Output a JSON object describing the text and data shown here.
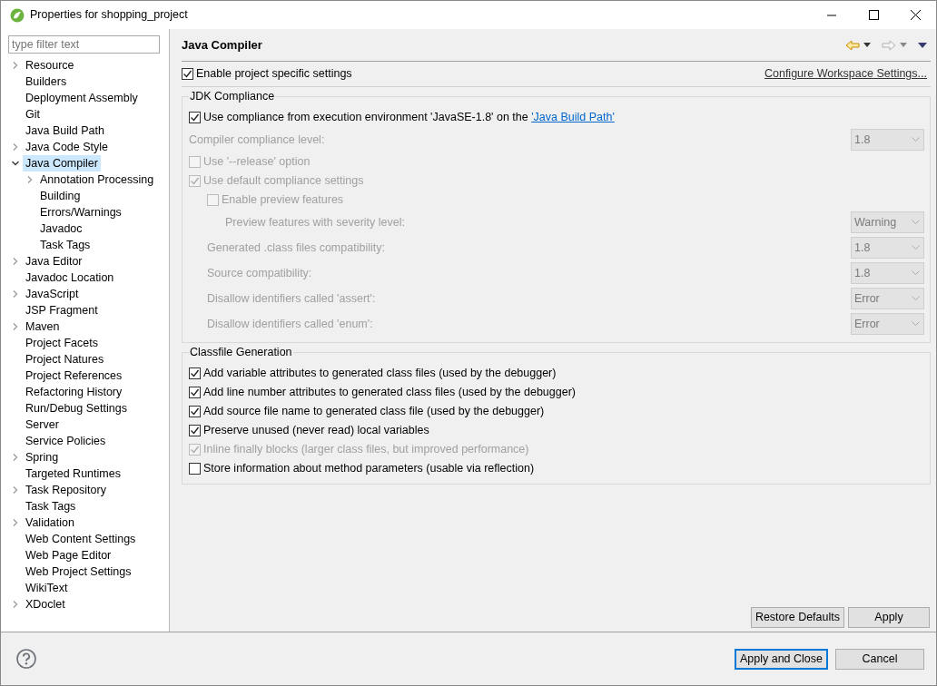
{
  "window": {
    "title": "Properties for shopping_project"
  },
  "sidebar": {
    "filter_placeholder": "type filter text",
    "items": [
      {
        "label": "Resource",
        "kind": "folder",
        "expanded": false,
        "selected": false
      },
      {
        "label": "Builders",
        "kind": "leaf",
        "selected": false
      },
      {
        "label": "Deployment Assembly",
        "kind": "leaf",
        "selected": false
      },
      {
        "label": "Git",
        "kind": "leaf",
        "selected": false
      },
      {
        "label": "Java Build Path",
        "kind": "leaf",
        "selected": false
      },
      {
        "label": "Java Code Style",
        "kind": "folder",
        "expanded": false,
        "selected": false
      },
      {
        "label": "Java Compiler",
        "kind": "folder",
        "expanded": true,
        "selected": true,
        "children": [
          {
            "label": "Annotation Processing",
            "kind": "folder",
            "expanded": false,
            "selected": false
          },
          {
            "label": "Building",
            "kind": "leaf",
            "selected": false
          },
          {
            "label": "Errors/Warnings",
            "kind": "leaf",
            "selected": false
          },
          {
            "label": "Javadoc",
            "kind": "leaf",
            "selected": false
          },
          {
            "label": "Task Tags",
            "kind": "leaf",
            "selected": false
          }
        ]
      },
      {
        "label": "Java Editor",
        "kind": "folder",
        "expanded": false,
        "selected": false
      },
      {
        "label": "Javadoc Location",
        "kind": "leaf",
        "selected": false
      },
      {
        "label": "JavaScript",
        "kind": "folder",
        "expanded": false,
        "selected": false
      },
      {
        "label": "JSP Fragment",
        "kind": "leaf",
        "selected": false
      },
      {
        "label": "Maven",
        "kind": "folder",
        "expanded": false,
        "selected": false
      },
      {
        "label": "Project Facets",
        "kind": "leaf",
        "selected": false
      },
      {
        "label": "Project Natures",
        "kind": "leaf",
        "selected": false
      },
      {
        "label": "Project References",
        "kind": "leaf",
        "selected": false
      },
      {
        "label": "Refactoring History",
        "kind": "leaf",
        "selected": false
      },
      {
        "label": "Run/Debug Settings",
        "kind": "leaf",
        "selected": false
      },
      {
        "label": "Server",
        "kind": "leaf",
        "selected": false
      },
      {
        "label": "Service Policies",
        "kind": "leaf",
        "selected": false
      },
      {
        "label": "Spring",
        "kind": "folder",
        "expanded": false,
        "selected": false
      },
      {
        "label": "Targeted Runtimes",
        "kind": "leaf",
        "selected": false
      },
      {
        "label": "Task Repository",
        "kind": "folder",
        "expanded": false,
        "selected": false
      },
      {
        "label": "Task Tags",
        "kind": "leaf",
        "selected": false
      },
      {
        "label": "Validation",
        "kind": "folder",
        "expanded": false,
        "selected": false
      },
      {
        "label": "Web Content Settings",
        "kind": "leaf",
        "selected": false
      },
      {
        "label": "Web Page Editor",
        "kind": "leaf",
        "selected": false
      },
      {
        "label": "Web Project Settings",
        "kind": "leaf",
        "selected": false
      },
      {
        "label": "WikiText",
        "kind": "leaf",
        "selected": false
      },
      {
        "label": "XDoclet",
        "kind": "folder",
        "expanded": false,
        "selected": false
      }
    ]
  },
  "page": {
    "title": "Java Compiler",
    "project_specific": {
      "label": "Enable project specific settings",
      "checked": true
    },
    "workspace_link": "Configure Workspace Settings...",
    "groups": [
      {
        "title": "JDK Compliance",
        "rows": [
          {
            "kind": "checkbox",
            "label": "Use compliance from execution environment 'JavaSE-1.8' on the ",
            "link": "'Java Build Path'",
            "checked": true,
            "disabled": false
          },
          {
            "kind": "combo",
            "label": "Compiler compliance level:",
            "value": "1.8",
            "disabled": true
          },
          {
            "kind": "checkbox",
            "label": "Use '--release' option",
            "checked": false,
            "disabled": true
          },
          {
            "kind": "checkbox",
            "label": "Use default compliance settings",
            "checked": true,
            "disabled": true,
            "children": [
              {
                "kind": "checkbox",
                "label": "Enable preview features",
                "checked": false,
                "disabled": true,
                "children": [
                  {
                    "kind": "combo",
                    "label": "Preview features with severity level:",
                    "value": "Warning",
                    "disabled": true
                  }
                ]
              },
              {
                "kind": "combo",
                "label": "Generated .class files compatibility:",
                "value": "1.8",
                "disabled": true
              },
              {
                "kind": "combo",
                "label": "Source compatibility:",
                "value": "1.8",
                "disabled": true
              },
              {
                "kind": "combo",
                "label": "Disallow identifiers called 'assert':",
                "value": "Error",
                "disabled": true
              },
              {
                "kind": "combo",
                "label": "Disallow identifiers called 'enum':",
                "value": "Error",
                "disabled": true
              }
            ]
          }
        ]
      },
      {
        "title": "Classfile Generation",
        "rows": [
          {
            "kind": "checkbox",
            "label": "Add variable attributes to generated class files (used by the debugger)",
            "checked": true,
            "disabled": false
          },
          {
            "kind": "checkbox",
            "label": "Add line number attributes to generated class files (used by the debugger)",
            "checked": true,
            "disabled": false
          },
          {
            "kind": "checkbox",
            "label": "Add source file name to generated class file (used by the debugger)",
            "checked": true,
            "disabled": false
          },
          {
            "kind": "checkbox",
            "label": "Preserve unused (never read) local variables",
            "checked": true,
            "disabled": false
          },
          {
            "kind": "checkbox",
            "label": "Inline finally blocks (larger class files, but improved performance)",
            "checked": true,
            "disabled": true
          },
          {
            "kind": "checkbox",
            "label": "Store information about method parameters (usable via reflection)",
            "checked": false,
            "disabled": false
          }
        ]
      }
    ],
    "page_buttons": [
      "Restore Defaults",
      "Apply"
    ]
  },
  "dialog_buttons": [
    {
      "label": "Apply and Close",
      "default": true
    },
    {
      "label": "Cancel",
      "default": false
    }
  ]
}
